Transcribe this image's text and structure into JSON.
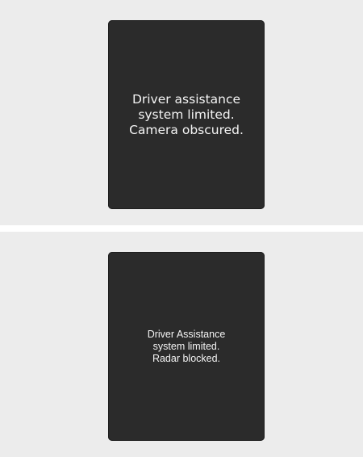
{
  "displays": [
    {
      "message": "Driver assistance\nsystem limited.\nCamera obscured."
    },
    {
      "message": "Driver Assistance\nsystem limited.\nRadar blocked."
    }
  ],
  "colors": {
    "panel_background": "#ececec",
    "screen_background": "#2b2b2b",
    "text": "#f4f4f4",
    "separator": "#ffffff"
  }
}
